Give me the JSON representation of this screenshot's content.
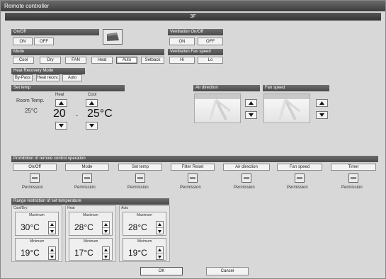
{
  "window": {
    "title": "Remote controller",
    "unit_name": "3F"
  },
  "onoff": {
    "header": "On/Off",
    "on": "ON",
    "off": "OFF"
  },
  "vent_onoff": {
    "header": "Ventilation On/Off",
    "on": "ON",
    "off": "OFF"
  },
  "mode": {
    "header": "Mode",
    "options": [
      "Cool",
      "Dry",
      "FAN",
      "Heat",
      "Auto",
      "Setback"
    ],
    "selected": "Auto"
  },
  "vent_fan": {
    "header": "Ventilation Fan speed",
    "hi": "Hi",
    "lo": "Lo"
  },
  "heat_recovery": {
    "header": "Heat Recovery Mode",
    "options": [
      "By-Pass",
      "Heat recov.",
      "Auto"
    ]
  },
  "settemp": {
    "header": "Set temp",
    "room_label": "Room Temp.",
    "room_value": "25°C",
    "heat_label": "Heat",
    "heat_value": "20",
    "dash": "-",
    "cool_label": "Cool",
    "cool_value": "25°C"
  },
  "air_direction": {
    "header": "Air direction"
  },
  "fan_speed": {
    "header": "Fan speed"
  },
  "prohibition": {
    "header": "Prohibition of remote control operation",
    "items": [
      {
        "label": "On/Off",
        "status": "Permission"
      },
      {
        "label": "Mode",
        "status": "Permission"
      },
      {
        "label": "Set temp",
        "status": "Permission"
      },
      {
        "label": "Filter Reset",
        "status": "Permission"
      },
      {
        "label": "Air direction",
        "status": "Permission"
      },
      {
        "label": "Fan speed",
        "status": "Permission"
      },
      {
        "label": "Timer",
        "status": "Permission"
      }
    ]
  },
  "range_limit": {
    "header": "Range restriction of set temperature",
    "groups": [
      {
        "title": "Cool/Dry",
        "max_label": "Maximum",
        "max_value": "30°C",
        "min_label": "Minimum",
        "min_value": "19°C"
      },
      {
        "title": "Heat",
        "max_label": "Maximum",
        "max_value": "28°C",
        "min_label": "Minimum",
        "min_value": "17°C"
      },
      {
        "title": "Auto",
        "max_label": "Maximum",
        "max_value": "28°C",
        "min_label": "Minimum",
        "min_value": "19°C"
      }
    ]
  },
  "footer": {
    "ok": "OK",
    "cancel": "Cancel"
  }
}
